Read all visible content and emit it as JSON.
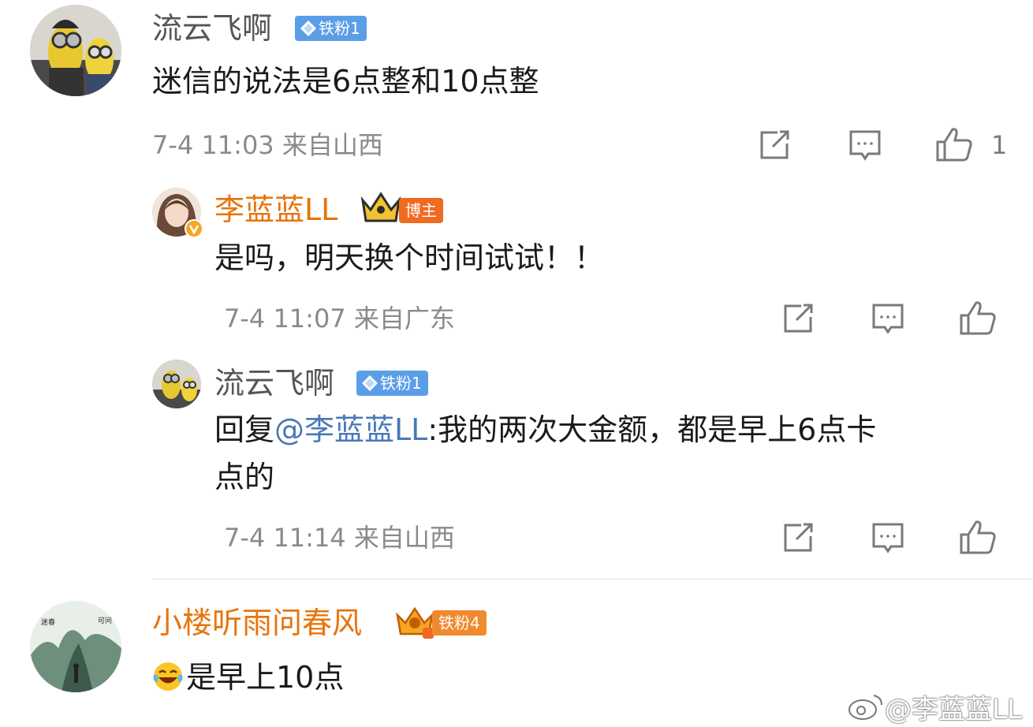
{
  "comments": [
    {
      "username": "流云飞啊",
      "badge": "铁粉1",
      "text": "迷信的说法是6点整和10点整",
      "meta": "7-4 11:03 来自山西",
      "like_count": "1",
      "replies": [
        {
          "username": "李蓝蓝LL",
          "badge": "博主",
          "text": "是吗，明天换个时间试试！！",
          "meta": "7-4 11:07 来自广东"
        },
        {
          "username": "流云飞啊",
          "badge": "铁粉1",
          "reply_prefix": "回复",
          "mention": "@李蓝蓝LL",
          "text": ":我的两次大金额，都是早上6点卡",
          "text_line2": "点的",
          "meta": "7-4 11:14 来自山西"
        }
      ]
    },
    {
      "username": "小楼听雨问春风",
      "badge": "铁粉4",
      "text": "是早上10点",
      "emoji": "laughing-tears-emoji"
    }
  ],
  "watermark": "@李蓝蓝LL",
  "colors": {
    "orange_name": "#e8740c",
    "fan_badge": "#5b9ee8",
    "host_badge": "#f06a22",
    "mention": "#4a78b8",
    "meta_gray": "#8a8a8a"
  },
  "icons": [
    "share-icon",
    "comment-icon",
    "like-icon"
  ]
}
